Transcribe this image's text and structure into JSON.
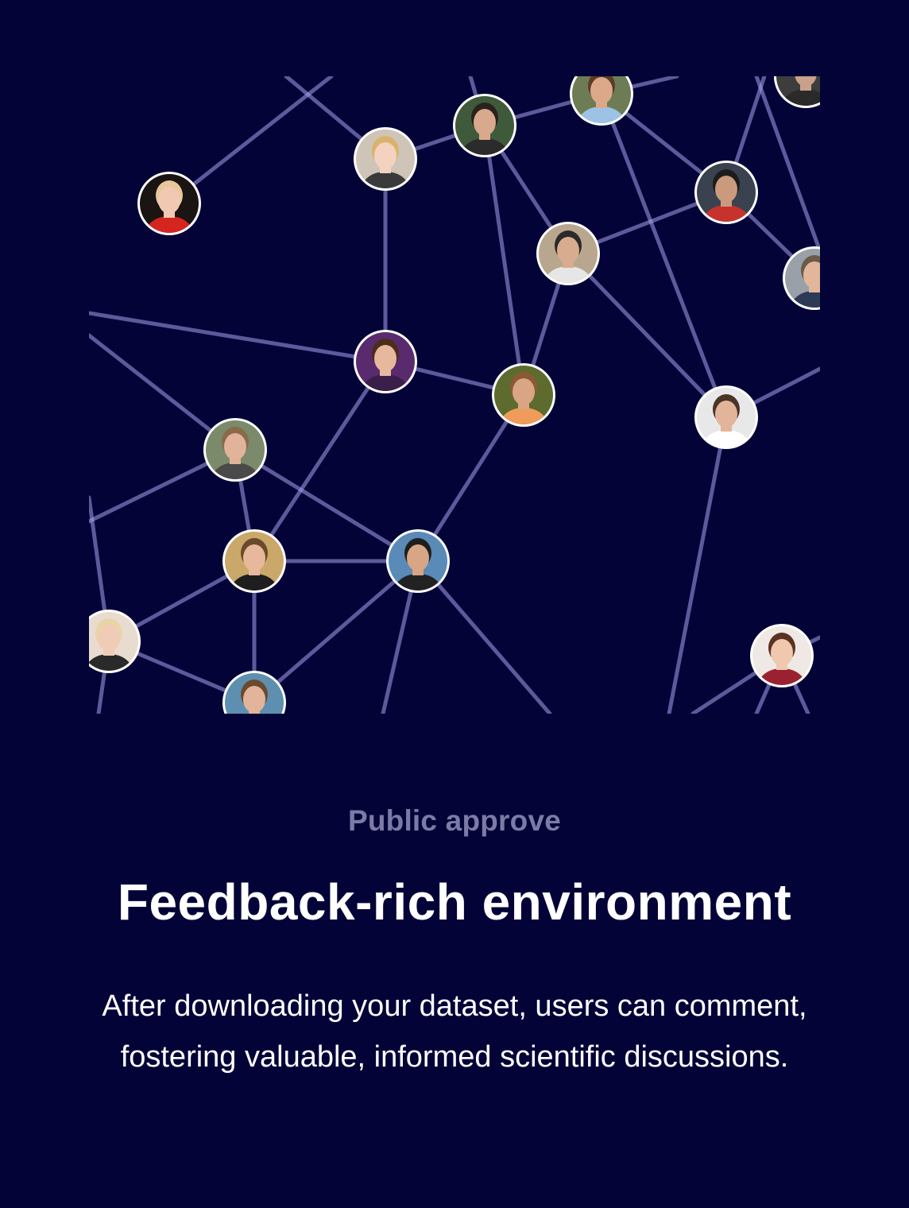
{
  "section": {
    "eyebrow": "Public approve",
    "headline": "Feedback-rich environment",
    "description": "After downloading your dataset, users can comment, fostering valuable, informed scientific discussions."
  },
  "colors": {
    "background": "#030338",
    "edge": "#aaa0eb",
    "eyebrow": "#7c7ba6",
    "avatar_ring": "#ffffff"
  },
  "avatars": [
    {
      "name": "avatar-woman-red-dress",
      "bg": "#1a1412",
      "skin": "#f1c9b2",
      "shirt": "#d4261f",
      "hair": "#e8c89a"
    },
    {
      "name": "avatar-blonde-woman",
      "bg": "#cfc4b8",
      "skin": "#f3d2c0",
      "shirt": "#3a3a3a",
      "hair": "#d9b36b"
    },
    {
      "name": "avatar-man-smiling",
      "bg": "#3f5a3a",
      "skin": "#d8a98c",
      "shirt": "#2b2b2b",
      "hair": "#2a221c"
    },
    {
      "name": "avatar-man-blue-shirt",
      "bg": "#6e7c55",
      "skin": "#dba98a",
      "shirt": "#9cc3e6",
      "hair": "#5a3d28"
    },
    {
      "name": "avatar-partial-top-right",
      "bg": "#3d3d3d",
      "skin": "#c9a08a",
      "shirt": "#2a2a2a",
      "hair": "#1e1e1e"
    },
    {
      "name": "avatar-man-red-tshirt",
      "bg": "#3a4250",
      "skin": "#c99a7c",
      "shirt": "#c8322c",
      "hair": "#1c1c1c"
    },
    {
      "name": "avatar-man-cap",
      "bg": "#b8a68e",
      "skin": "#d8ac8e",
      "shirt": "#e6e6e6",
      "hair": "#2a2a2a"
    },
    {
      "name": "avatar-man-suit-right",
      "bg": "#9aa0a8",
      "skin": "#e2b69b",
      "shirt": "#2d3a55",
      "hair": "#6b5a48"
    },
    {
      "name": "avatar-man-purple",
      "bg": "#5a2a6e",
      "skin": "#e6b89e",
      "shirt": "#3a1f4a",
      "hair": "#4a2e1c"
    },
    {
      "name": "avatar-man-beard-orange",
      "bg": "#5d6b2e",
      "skin": "#d9a584",
      "shirt": "#f09b5a",
      "hair": "#8a5a34"
    },
    {
      "name": "avatar-man-white-shirt",
      "bg": "#e8e8e8",
      "skin": "#e2b59a",
      "shirt": "#ffffff",
      "hair": "#4a3426"
    },
    {
      "name": "avatar-man-glasses",
      "bg": "#7a8a6a",
      "skin": "#e0b39a",
      "shirt": "#4a4a4a",
      "hair": "#8a6a4a"
    },
    {
      "name": "avatar-man-headset",
      "bg": "#c9a86a",
      "skin": "#e8b89c",
      "shirt": "#1e1e1e",
      "hair": "#6a4a2a"
    },
    {
      "name": "avatar-man-sunglasses",
      "bg": "#5a8ab8",
      "skin": "#d8a684",
      "shirt": "#222222",
      "hair": "#1e1e1e"
    },
    {
      "name": "avatar-woman-glasses",
      "bg": "#e8dcd0",
      "skin": "#f0ccb6",
      "shirt": "#2a2a2a",
      "hair": "#e8d4a8"
    },
    {
      "name": "avatar-man-bottom",
      "bg": "#5f8fb0",
      "skin": "#e2b49a",
      "shirt": "#3a4a5a",
      "hair": "#6a4a2e"
    },
    {
      "name": "avatar-woman-red-top",
      "bg": "#efe8e4",
      "skin": "#f0c8ae",
      "shirt": "#9a2230",
      "hair": "#5a3222"
    }
  ]
}
